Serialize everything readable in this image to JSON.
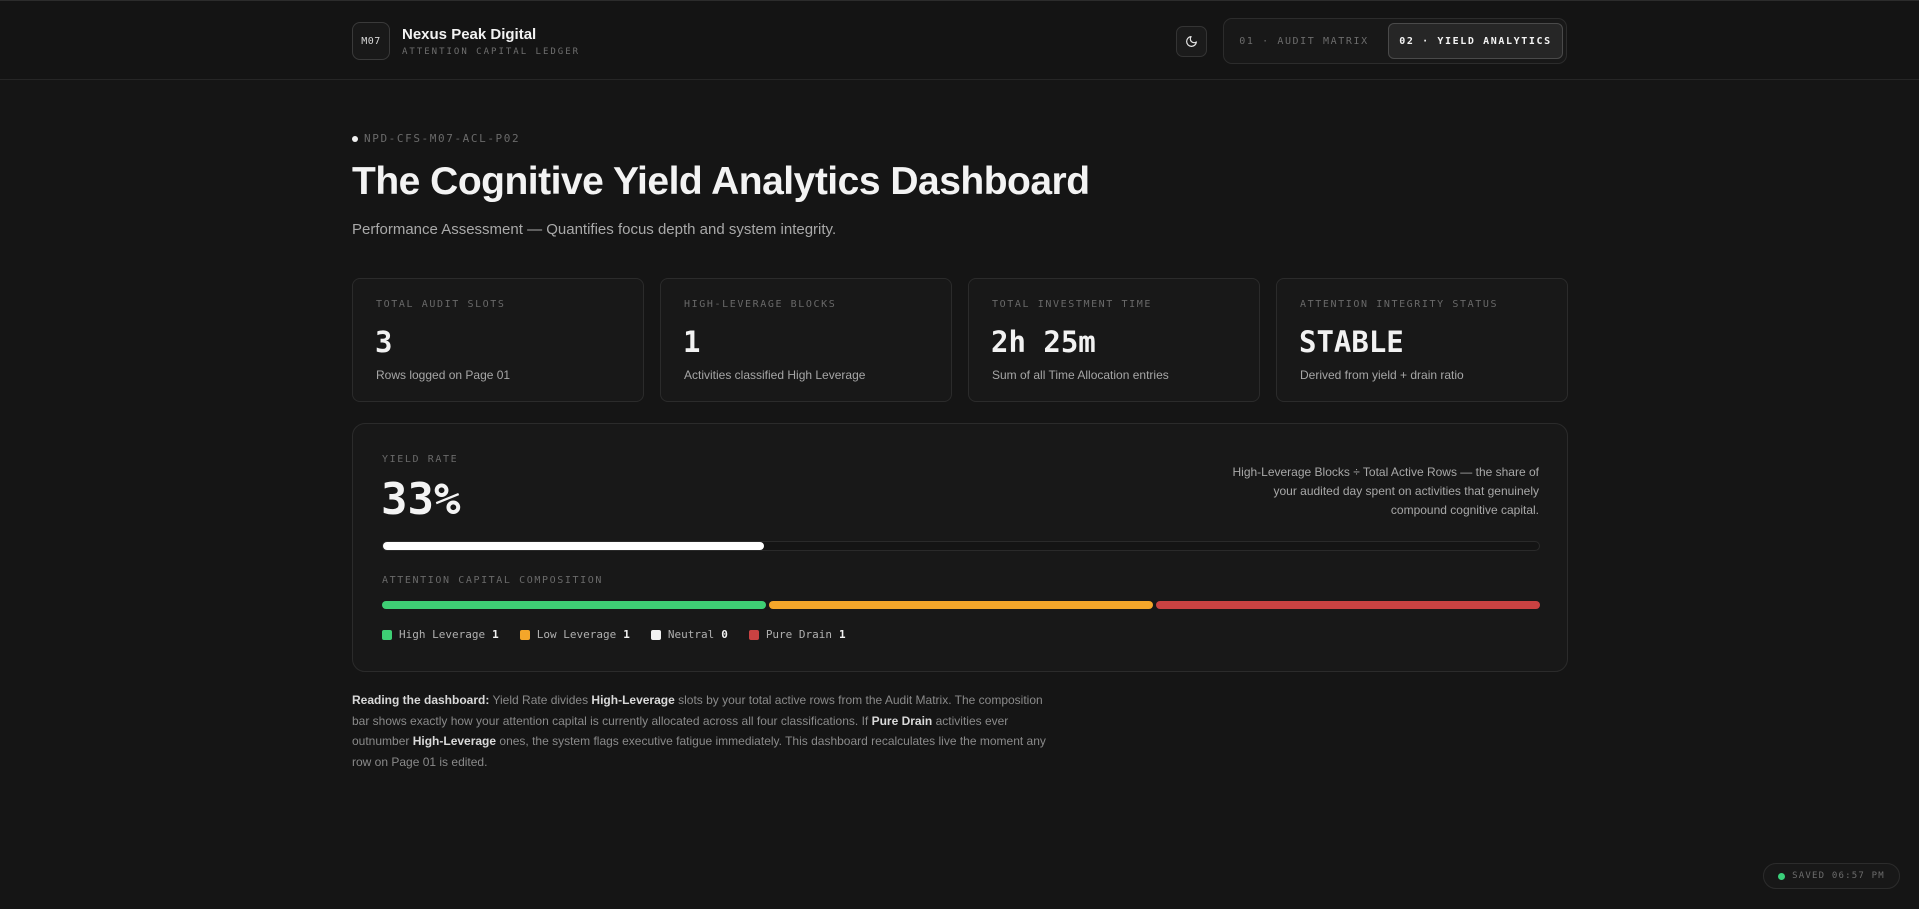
{
  "header": {
    "logo_text": "M07",
    "brand_name": "Nexus Peak Digital",
    "brand_sub": "ATTENTION CAPITAL LEDGER",
    "theme_icon": "moon-icon",
    "tabs": [
      {
        "label": "01 · AUDIT MATRIX",
        "active": false
      },
      {
        "label": "02 · YIELD ANALYTICS",
        "active": true
      }
    ]
  },
  "hero": {
    "doc_id": "NPD-CFS-M07-ACL-P02",
    "title": "The Cognitive Yield Analytics Dashboard",
    "subtitle": "Performance Assessment — Quantifies focus depth and system integrity."
  },
  "stats": [
    {
      "label": "TOTAL AUDIT SLOTS",
      "value": "3",
      "desc": "Rows logged on Page 01"
    },
    {
      "label": "HIGH-LEVERAGE BLOCKS",
      "value": "1",
      "desc": "Activities classified High Leverage"
    },
    {
      "label": "TOTAL INVESTMENT TIME",
      "value": "2h 25m",
      "desc": "Sum of all Time Allocation entries"
    },
    {
      "label": "ATTENTION INTEGRITY STATUS",
      "value": "STABLE",
      "desc": "Derived from yield + drain ratio"
    }
  ],
  "yield": {
    "label": "YIELD RATE",
    "value": "33%",
    "progress": 0.33,
    "note": "High-Leverage Blocks ÷ Total Active Rows — the share of your audited day spent on activities that genuinely compound cognitive capital."
  },
  "composition": {
    "label": "ATTENTION CAPITAL COMPOSITION",
    "items": [
      {
        "name": "High Leverage",
        "count": "1",
        "color": "#3ecf74"
      },
      {
        "name": "Low Leverage",
        "count": "1",
        "color": "#f4a62a"
      },
      {
        "name": "Neutral",
        "count": "0",
        "color": "#f2f2f2"
      },
      {
        "name": "Pure Drain",
        "count": "1",
        "color": "#c94242"
      }
    ]
  },
  "explanation": {
    "lead": "Reading the dashboard:",
    "t1": " Yield Rate divides ",
    "b1": "High-Leverage",
    "t2": " slots by your total active rows from the Audit Matrix. The composition bar shows exactly how your attention capital is currently allocated across all four classifications. If ",
    "b2": "Pure Drain",
    "t3": " activities ever outnumber ",
    "b3": "High-Leverage",
    "t4": " ones, the system flags executive fatigue immediately. This dashboard recalculates live the moment any row on Page 01 is edited."
  },
  "status": {
    "saved": "SAVED 06:57 PM"
  }
}
